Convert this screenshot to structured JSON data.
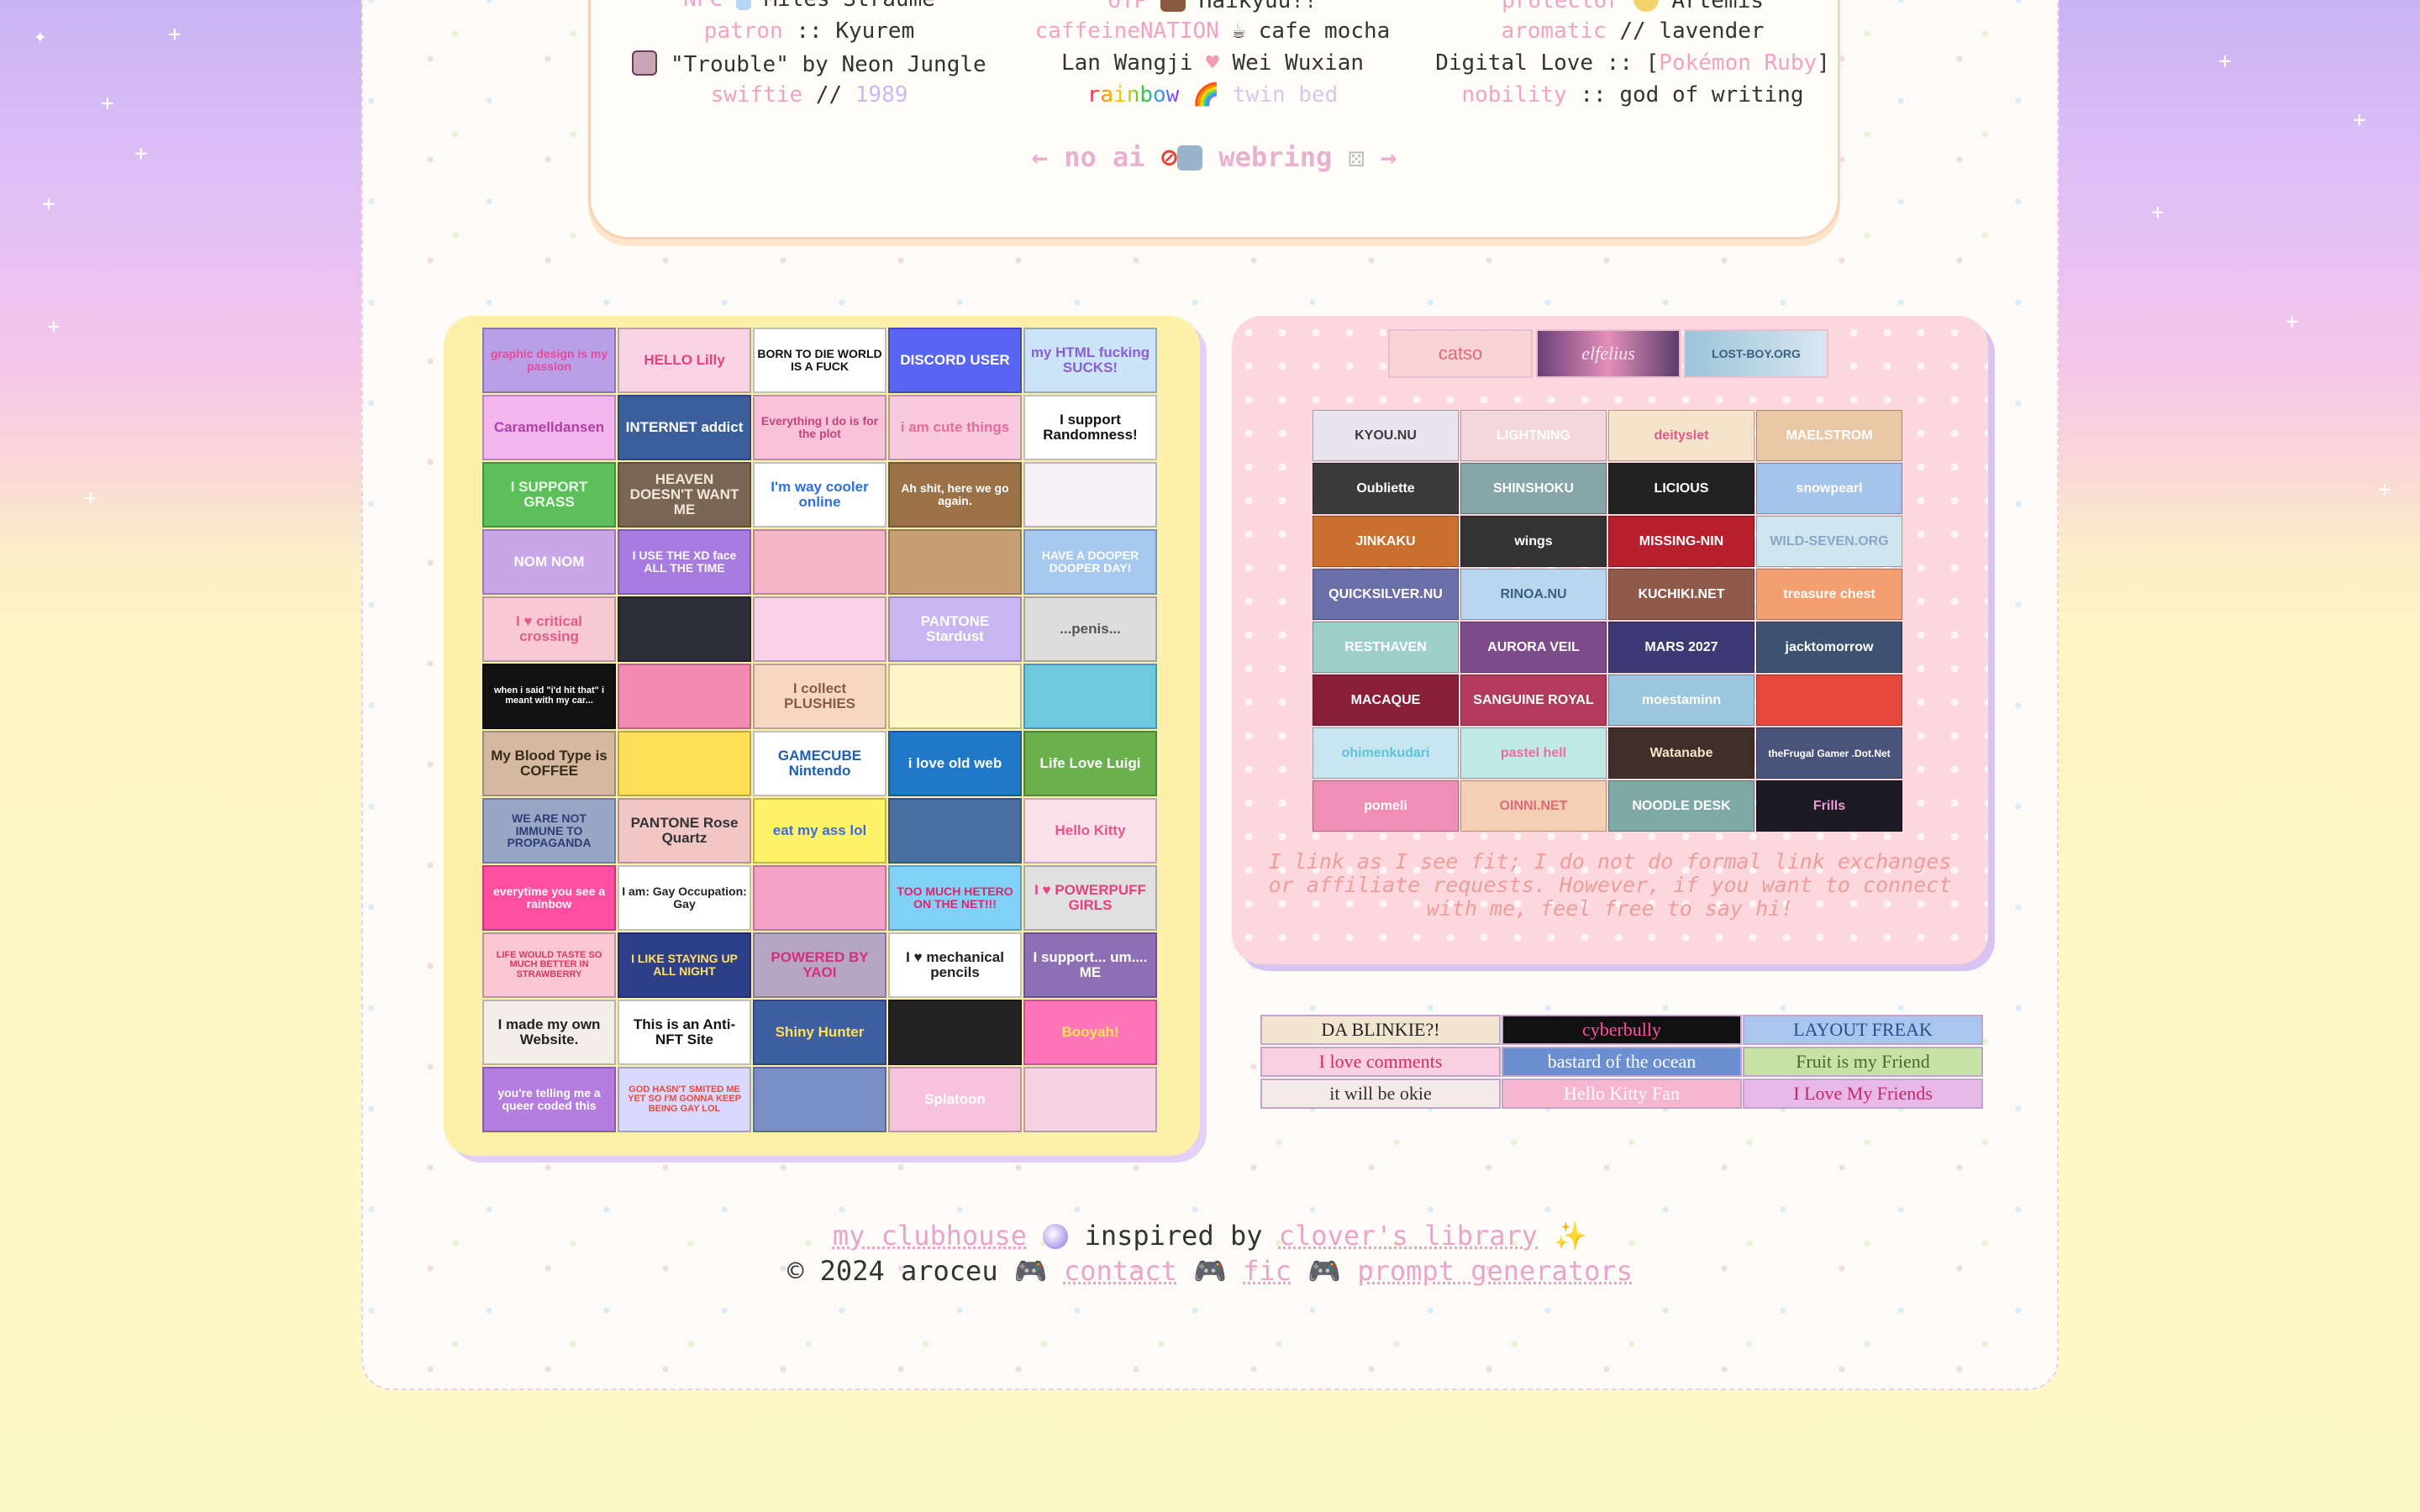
{
  "profile": {
    "rows": [
      {
        "c1_key": "NFC",
        "c1_val": "Miles Straume",
        "c2_key": "OTP",
        "c2_val": "Haikyuu!!",
        "c3_key": "protector",
        "c3_val": "Artemis"
      },
      {
        "c1_key": "patron",
        "c1_sep": "::",
        "c1_val": "Kyurem",
        "c2_key": "caffeineNATION",
        "c2_val": "cafe mocha",
        "c3_key": "aromatic",
        "c3_sep": "//",
        "c3_val": "lavender"
      },
      {
        "c1_val": "\"Trouble\" by Neon Jungle",
        "c2_val_a": "Lan Wangji",
        "c2_val_b": "Wei Wuxian",
        "c3_val_a": "Digital Love :: [",
        "c3_key": "Pokémon Ruby",
        "c3_val_b": "]"
      },
      {
        "c1_key": "swiftie",
        "c1_sep": "//",
        "c1_val": "1989",
        "c2_key": "rainbow",
        "c2_val": "twin bed",
        "c3_key": "nobility",
        "c3_sep": "::",
        "c3_val": "god of writing"
      }
    ],
    "webring": {
      "prev": "←",
      "label_a": "no ai",
      "label_b": "webring",
      "next": "→"
    }
  },
  "buttons88": [
    "graphic design is my passion",
    "HELLO Lilly",
    "BORN TO DIE WORLD IS A FUCK",
    "DISCORD USER",
    "my HTML fucking SUCKS!",
    "Caramelldansen",
    "INTERNET addict",
    "Everything I do is for the plot",
    "i am cute things",
    "I support Randomness!",
    "I SUPPORT GRASS",
    "HEAVEN DOESN'T WANT ME",
    "I'm way cooler online",
    "Ah shit, here we go again.",
    "",
    "NOM NOM",
    "I USE THE XD face ALL THE TIME",
    "",
    "",
    "HAVE A DOOPER DOOPER DAY!",
    "I ♥ critical crossing",
    "",
    "",
    "PANTONE Stardust",
    "...penis...",
    "when i said \"i'd hit that\" i meant with my car...",
    "",
    "I collect PLUSHIES",
    "",
    "",
    "My Blood Type is COFFEE",
    "",
    "GAMECUBE Nintendo",
    "i love old web",
    "Life Love Luigi",
    "WE ARE NOT IMMUNE TO PROPAGANDA",
    "PANTONE Rose Quartz",
    "eat my ass lol",
    "",
    "Hello Kitty",
    "everytime you see a rainbow",
    "I am: Gay Occupation: Gay",
    "",
    "TOO MUCH HETERO ON THE NET!!!",
    "I ♥ POWERPUFF GIRLS",
    "LIFE WOULD TASTE SO MUCH BETTER IN STRAWBERRY",
    "I LIKE STAYING UP ALL NIGHT",
    "POWERED BY YAOI",
    "I ♥ mechanical pencils",
    "I support... um.... ME",
    "I made my own Website.",
    "This is an Anti-NFT Site",
    "Shiny Hunter",
    "",
    "Booyah!",
    "you're telling me a queer coded this",
    "GOD HASN'T SMITED ME YET SO I'M GONNA KEEP BEING GAY LOL",
    "",
    "Splatoon",
    ""
  ],
  "top_buttons": [
    "catso",
    "elfelius",
    "LOST-BOY.ORG"
  ],
  "buttons_linked": [
    "KYOU.NU",
    "LIGHTNING",
    "deityslet",
    "MAELSTROM",
    "Oubliette",
    "SHINSHOKU",
    "LICIOUS",
    "snowpearl",
    "JINKAKU",
    "wings",
    "MISSING-NIN",
    "WILD-SEVEN.ORG",
    "QUICKSILVER.NU",
    "RINOA.NU",
    "KUCHIKI.NET",
    "treasure chest",
    "RESTHAVEN",
    "AURORA VEIL",
    "MARS 2027",
    "jacktomorrow",
    "MACAQUE",
    "SANGUINE ROYAL",
    "moestaminn",
    "",
    "ohimenkudari",
    "pastel hell",
    "Watanabe",
    "theFrugal Gamer .Dot.Net",
    "pomeli",
    "OINNI.NET",
    "NOODLE DESK",
    "Frills"
  ],
  "link_note": "I link as I see fit; I do not do formal link exchanges or affiliate requests. However, if you want to connect with me, feel free to say hi!",
  "banners": [
    "DA BLINKIE?!",
    "cyberbully",
    "LAYOUT FREAK",
    "I love comments",
    "bastard of the ocean",
    "Fruit is my Friend",
    "it will be okie",
    "Hello Kitty Fan",
    "I Love My Friends"
  ],
  "footer": {
    "clubhouse": "my clubhouse",
    "inspired": "inspired by",
    "library": "clover's library",
    "copyright": "© 2024 aroceu",
    "contact": "contact",
    "fic": "fic",
    "prompts": "prompt generators"
  },
  "colors": {
    "pink": "#f2a3c5",
    "lavender": "#c9b8f0",
    "yellow_box": "#fdf0a8",
    "pink_box": "#fcd7de"
  }
}
